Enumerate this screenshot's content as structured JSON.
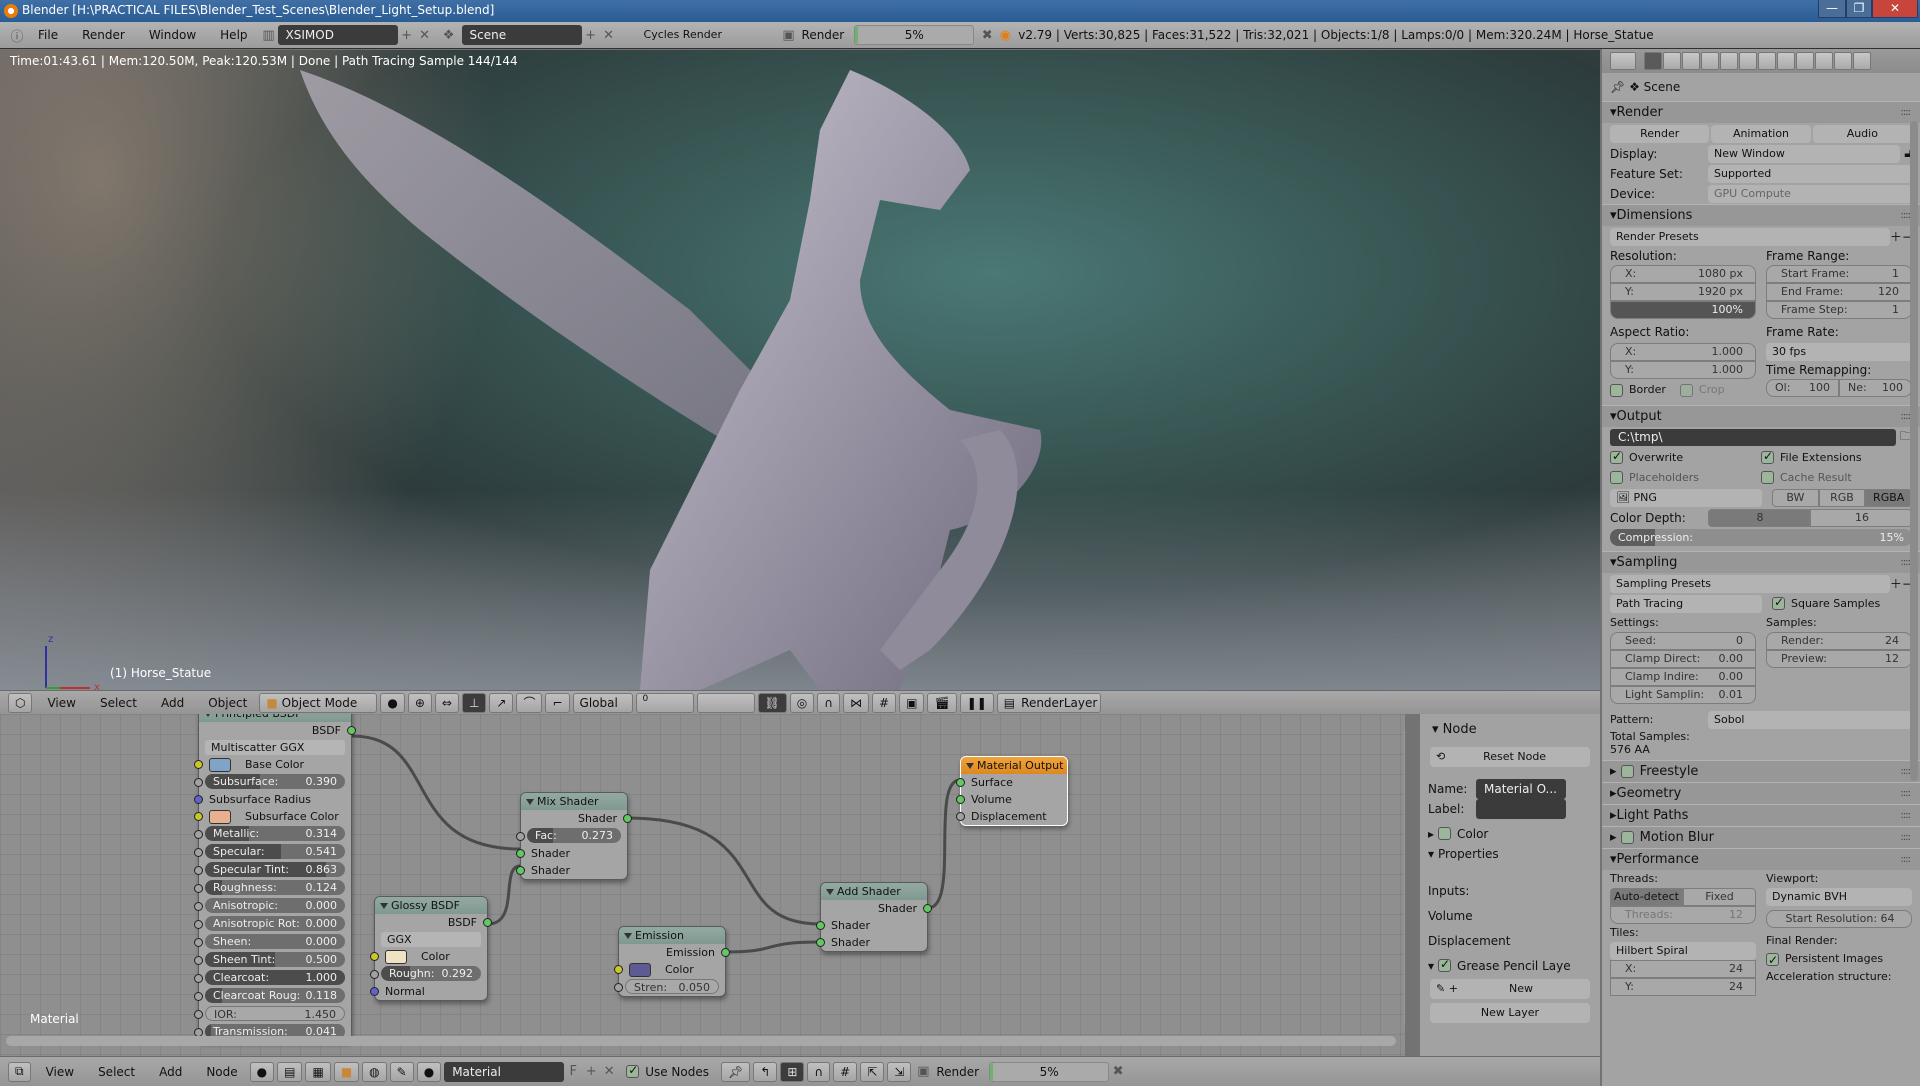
{
  "window": {
    "title": "Blender [H:\\PRACTICAL FILES\\Blender_Test_Scenes\\Blender_Light_Setup.blend]",
    "controls": {
      "minimize": "—",
      "restore": "❐",
      "close": "✕"
    }
  },
  "info_header": {
    "menus": [
      "File",
      "Render",
      "Window",
      "Help"
    ],
    "screen_layout": "XSIMOD",
    "scene": "Scene",
    "engine": "Cycles Render",
    "render_label": "Render",
    "render_progress_text": "5%",
    "render_progress": 0.05,
    "stats": "v2.79 | Verts:30,825 | Faces:31,522 | Tris:32,021 | Objects:1/8 | Lamps:0/0 | Mem:320.24M | Horse_Statue"
  },
  "viewport": {
    "status": "Time:01:43.61 | Mem:120.50M, Peak:120.53M | Done | Path Tracing Sample 144/144",
    "object_label": "(1) Horse_Statue",
    "axis_labels": {
      "x": "x",
      "z": "z"
    },
    "header": {
      "menus": [
        "View",
        "Select",
        "Add",
        "Object"
      ],
      "mode": "Object Mode",
      "orientation": "Global",
      "layer_indicator": "0",
      "render_layer": "RenderLayer"
    }
  },
  "node_editor": {
    "context_label": "Material",
    "nodes": {
      "principled": {
        "title": "Principled BSDF",
        "output": "BSDF",
        "distribution": "Multiscatter GGX",
        "base_color_label": "Base Color",
        "base_color": "#7fa4c8",
        "subsurface_radius": "Subsurface Radius",
        "subsurface_color_label": "Subsurface Color",
        "subsurface_color": "#e8b08f",
        "sliders": [
          {
            "label": "Subsurface:",
            "value": "0.390",
            "fraction": 0.39
          },
          {
            "label": "Metallic:",
            "value": "0.314",
            "fraction": 0.314
          },
          {
            "label": "Specular:",
            "value": "0.541",
            "fraction": 0.541
          },
          {
            "label": "Specular Tint:",
            "value": "0.863",
            "fraction": 0.863
          },
          {
            "label": "Roughness:",
            "value": "0.124",
            "fraction": 0.124
          },
          {
            "label": "Anisotropic:",
            "value": "0.000",
            "fraction": 0
          },
          {
            "label": "Anisotropic Rot:",
            "value": "0.000",
            "fraction": 0
          },
          {
            "label": "Sheen:",
            "value": "0.000",
            "fraction": 0
          },
          {
            "label": "Sheen Tint:",
            "value": "0.500",
            "fraction": 0.5
          },
          {
            "label": "Clearcoat:",
            "value": "1.000",
            "fraction": 1
          },
          {
            "label": "Clearcoat Roug:",
            "value": "0.118",
            "fraction": 0.118
          },
          {
            "label": "IOR:",
            "value": "1.450",
            "fraction": 0
          },
          {
            "label": "Transmission:",
            "value": "0.041",
            "fraction": 0.041
          }
        ]
      },
      "mix": {
        "title": "Mix Shader",
        "output": "Shader",
        "fac_label": "Fac:",
        "fac_value": "0.273",
        "fac": 0.273,
        "inputs": [
          "Shader",
          "Shader"
        ]
      },
      "glossy": {
        "title": "Glossy BSDF",
        "output": "BSDF",
        "distribution": "GGX",
        "color_label": "Color",
        "color": "#efe3c3",
        "rough_label": "Roughn:",
        "rough_value": "0.292",
        "rough": 0.292,
        "normal": "Normal"
      },
      "emission": {
        "title": "Emission",
        "output": "Emission",
        "color_label": "Color",
        "color": "#5e5b92",
        "strength_label": "Stren:",
        "strength_value": "0.050"
      },
      "add": {
        "title": "Add Shader",
        "output": "Shader",
        "inputs": [
          "Shader",
          "Shader"
        ]
      },
      "output": {
        "title": "Material Output",
        "inputs": [
          "Surface",
          "Volume",
          "Displacement"
        ]
      }
    },
    "sidebar": {
      "node_panel": "Node",
      "reset_node": "Reset Node",
      "name_label": "Name:",
      "name_value": "Material O...",
      "label_label": "Label:",
      "label_value": "",
      "color_panel": "Color",
      "properties_panel": "Properties",
      "inputs_label": "Inputs:",
      "inputs": [
        "Volume",
        "Displacement"
      ],
      "grease_panel": "Grease Pencil Laye",
      "new_button": "New",
      "new_layer_button": "New Layer"
    },
    "header": {
      "menus": [
        "View",
        "Select",
        "Add",
        "Node"
      ],
      "material": "Material",
      "fake_user": "F",
      "use_nodes_label": "Use Nodes",
      "use_nodes": true,
      "render_label": "Render",
      "render_progress_text": "5%",
      "render_progress": 0.05
    }
  },
  "properties": {
    "context": "Scene",
    "render_panel": {
      "title": "Render",
      "buttons": [
        "Render",
        "Animation",
        "Audio"
      ],
      "display_label": "Display:",
      "display": "New Window",
      "feature_label": "Feature Set:",
      "feature": "Supported",
      "device_label": "Device:",
      "device": "GPU Compute"
    },
    "dimensions_panel": {
      "title": "Dimensions",
      "presets": "Render Presets",
      "resolution_label": "Resolution:",
      "res_x": {
        "label": "X:",
        "value": "1080 px"
      },
      "res_y": {
        "label": "Y:",
        "value": "1920 px"
      },
      "res_pct": "100%",
      "frame_range_label": "Frame Range:",
      "start": {
        "label": "Start Frame:",
        "value": "1"
      },
      "end": {
        "label": "End Frame:",
        "value": "120"
      },
      "step": {
        "label": "Frame Step:",
        "value": "1"
      },
      "aspect_label": "Aspect Ratio:",
      "asp_x": {
        "label": "X:",
        "value": "1.000"
      },
      "asp_y": {
        "label": "Y:",
        "value": "1.000"
      },
      "frame_rate_label": "Frame Rate:",
      "frame_rate": "30 fps",
      "remap_label": "Time Remapping:",
      "remap_old": {
        "label": "Ol:",
        "value": "100"
      },
      "remap_new": {
        "label": "Ne:",
        "value": "100"
      },
      "border": "Border",
      "crop": "Crop"
    },
    "output_panel": {
      "title": "Output",
      "path": "C:\\tmp\\",
      "overwrite": "Overwrite",
      "file_ext": "File Extensions",
      "placeholders": "Placeholders",
      "cache": "Cache Result",
      "format": "PNG",
      "color_modes": [
        "BW",
        "RGB",
        "RGBA"
      ],
      "color_mode_active": "RGBA",
      "depth_label": "Color Depth:",
      "depths": [
        "8",
        "16"
      ],
      "depth_active": "8",
      "compression_label": "Compression:",
      "compression_value": "15%",
      "compression": 0.15
    },
    "sampling_panel": {
      "title": "Sampling",
      "presets": "Sampling Presets",
      "integrator": "Path Tracing",
      "square_samples": "Square Samples",
      "settings_label": "Settings:",
      "seed": {
        "label": "Seed:",
        "value": "0"
      },
      "clamp_direct": {
        "label": "Clamp Direct:",
        "value": "0.00"
      },
      "clamp_indirect": {
        "label": "Clamp Indire:",
        "value": "0.00"
      },
      "light_sampling": {
        "label": "Light Samplin:",
        "value": "0.01"
      },
      "samples_label": "Samples:",
      "render": {
        "label": "Render:",
        "value": "24"
      },
      "preview": {
        "label": "Preview:",
        "value": "12"
      },
      "pattern_label": "Pattern:",
      "pattern": "Sobol",
      "total_label": "Total Samples:",
      "total": "576 AA"
    },
    "collapsed_panels": [
      "Freestyle",
      "Geometry",
      "Light Paths",
      "Motion Blur"
    ],
    "performance_panel": {
      "title": "Performance",
      "threads_label": "Threads:",
      "threads_modes": [
        "Auto-detect",
        "Fixed"
      ],
      "threads": {
        "label": "Threads:",
        "value": "12"
      },
      "tiles_label": "Tiles:",
      "tile_order": "Hilbert Spiral",
      "tile_x": {
        "label": "X:",
        "value": "24"
      },
      "tile_y": {
        "label": "Y:",
        "value": "24"
      },
      "viewport_label": "Viewport:",
      "viewport_bvh": "Dynamic BVH",
      "start_res": "Start Resolution: 64",
      "final_label": "Final Render:",
      "persistent": "Persistent Images",
      "accel_label": "Acceleration structure:"
    }
  }
}
